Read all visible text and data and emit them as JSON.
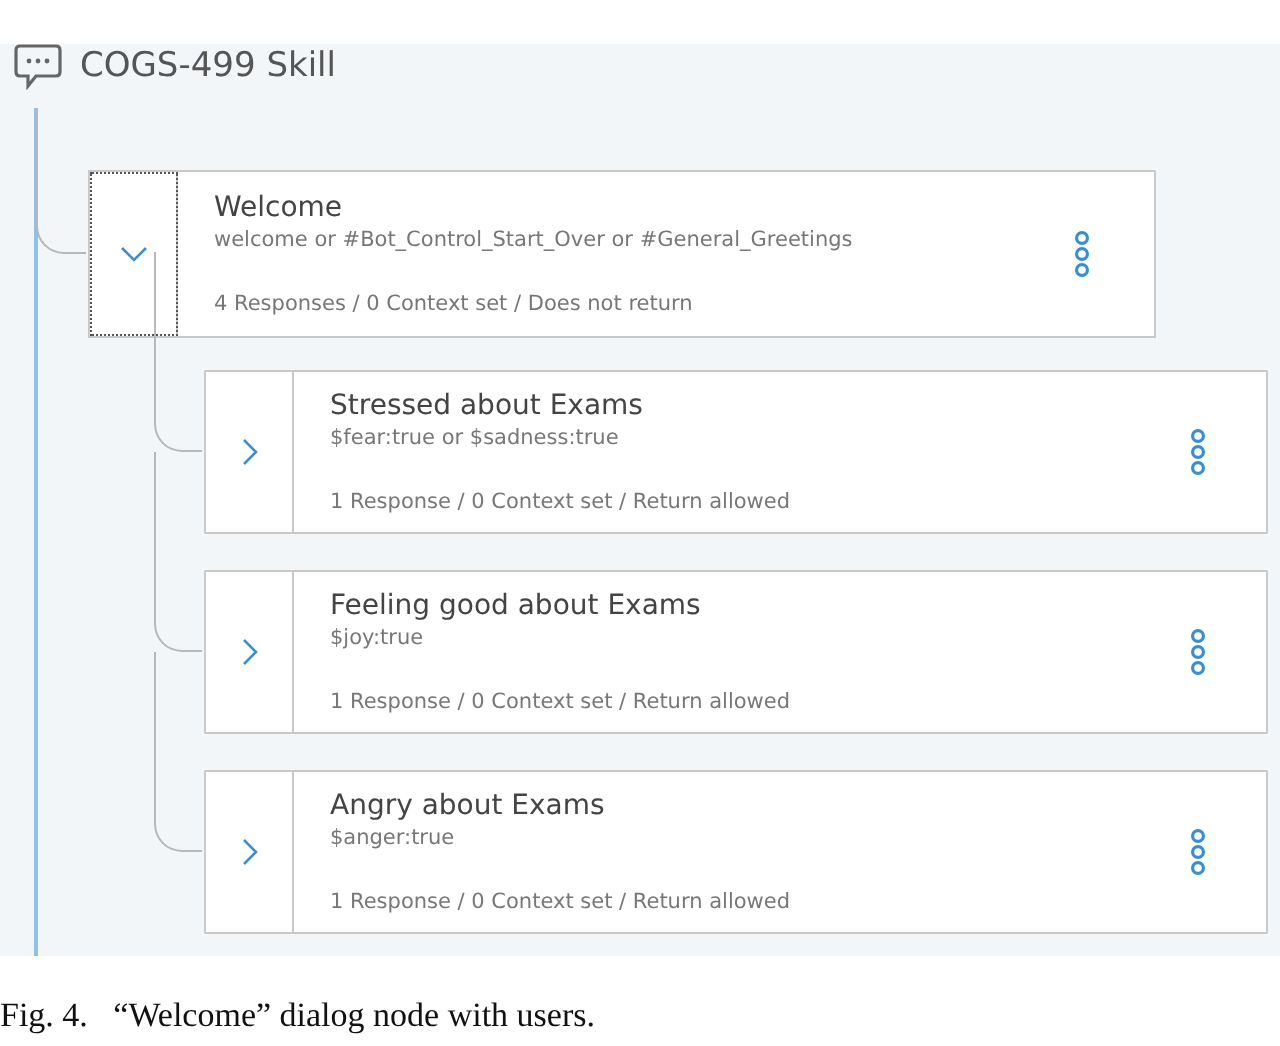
{
  "skill": {
    "title": "COGS-499 Skill"
  },
  "nodes": [
    {
      "title": "Welcome",
      "condition": "welcome or #Bot_Control_Start_Over or #General_Greetings",
      "summary": "4 Responses / 0 Context set / Does not return",
      "expanded": true,
      "selected": true,
      "children": [
        {
          "title": "Stressed about Exams",
          "condition": "$fear:true or $sadness:true",
          "summary": "1 Response / 0 Context set / Return allowed",
          "expanded": false,
          "selected": false
        },
        {
          "title": "Feeling good about Exams",
          "condition": "$joy:true",
          "summary": "1 Response / 0 Context set / Return allowed",
          "expanded": false,
          "selected": false
        },
        {
          "title": "Angry about Exams",
          "condition": "$anger:true",
          "summary": "1 Response / 0 Context set / Return allowed",
          "expanded": false,
          "selected": false
        }
      ]
    }
  ],
  "caption": "Fig. 4.   “Welcome” dialog node with users."
}
